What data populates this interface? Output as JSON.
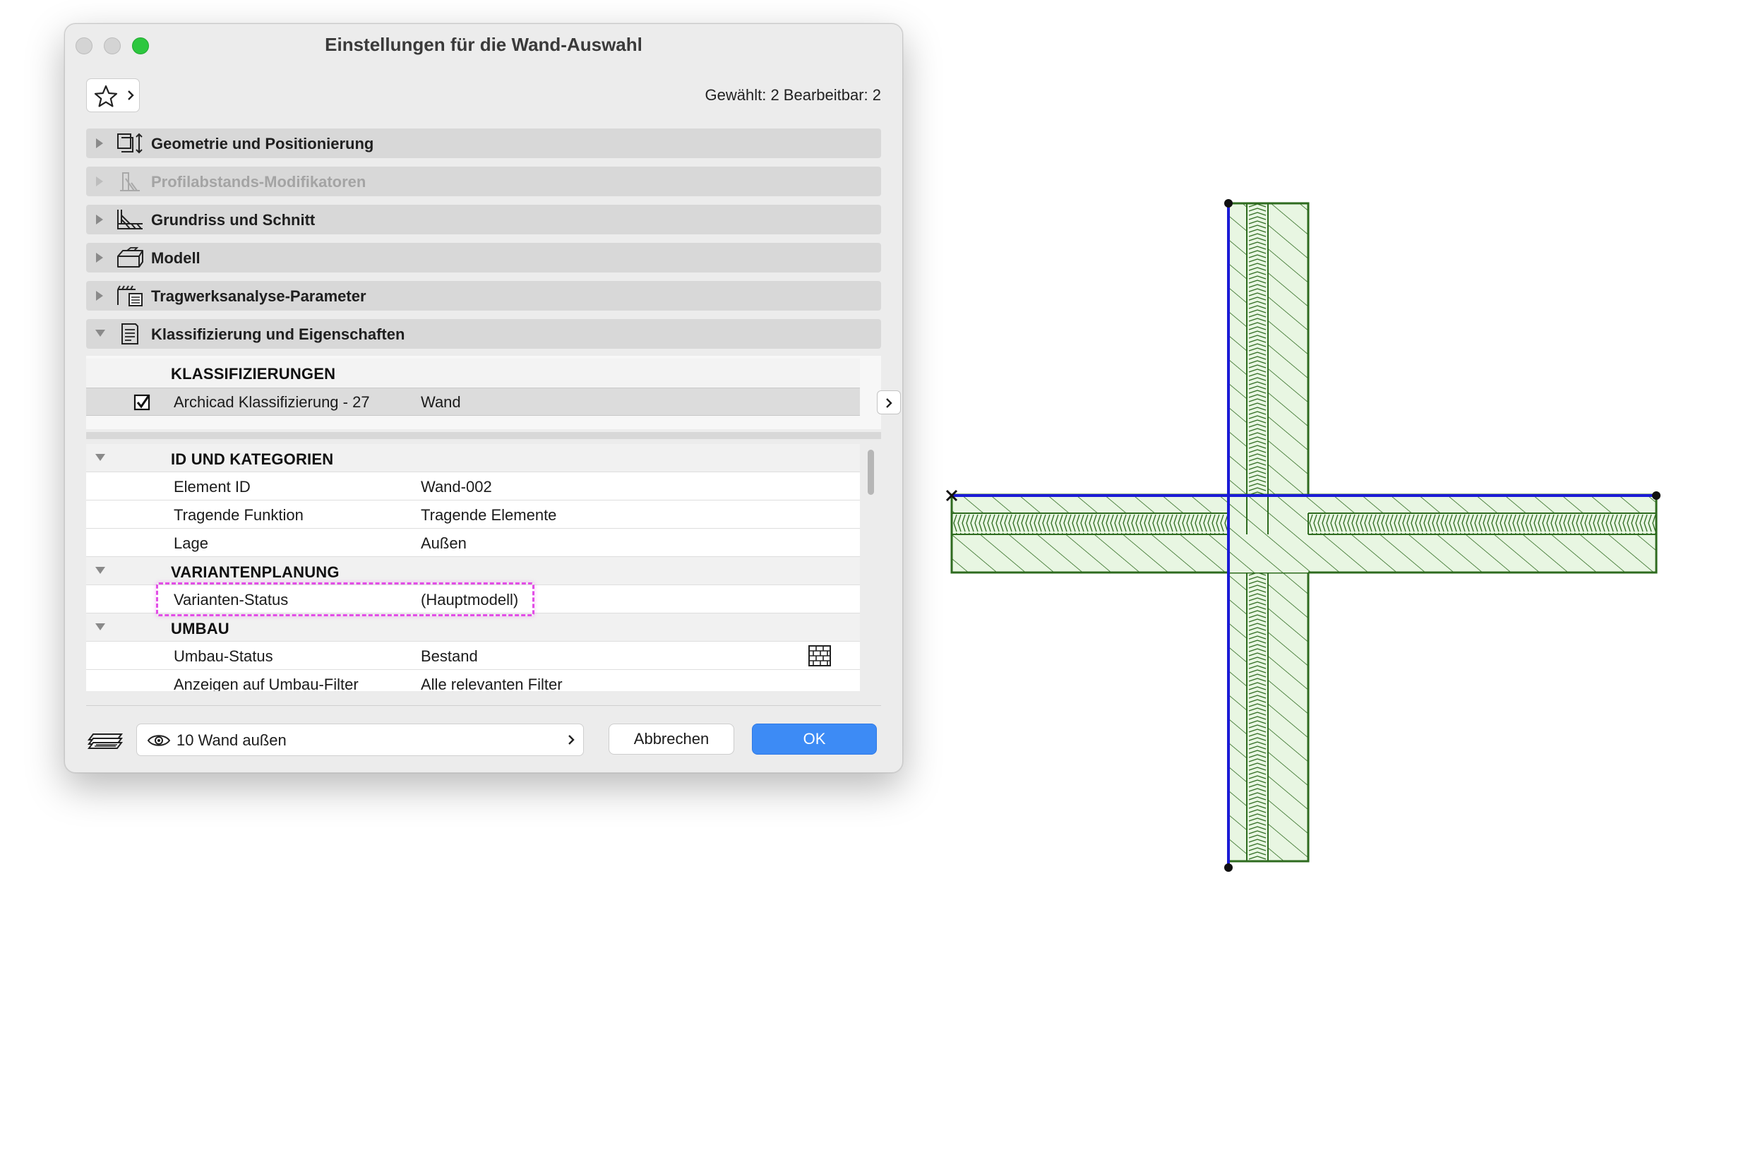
{
  "window": {
    "title": "Einstellungen für die Wand-Auswahl"
  },
  "selection_info": "Gewählt: 2 Bearbeitbar: 2",
  "sections": [
    {
      "label": "Geometrie und Positionierung",
      "icon": "geometry-icon",
      "state": "collapsed",
      "enabled": true
    },
    {
      "label": "Profilabstands-Modifikatoren",
      "icon": "profile-modifier-icon",
      "state": "collapsed",
      "enabled": false
    },
    {
      "label": "Grundriss und Schnitt",
      "icon": "floor-plan-icon",
      "state": "collapsed",
      "enabled": true
    },
    {
      "label": "Modell",
      "icon": "model-icon",
      "state": "collapsed",
      "enabled": true
    },
    {
      "label": "Tragwerksanalyse-Parameter",
      "icon": "structural-analysis-icon",
      "state": "collapsed",
      "enabled": true
    },
    {
      "label": "Klassifizierung und Eigenschaften",
      "icon": "classification-icon",
      "state": "expanded",
      "enabled": true
    }
  ],
  "classifications": {
    "header": "KLASSIFIZIERUNGEN",
    "rows": [
      {
        "checked": true,
        "name": "Archicad Klassifizierung - 27",
        "value": "Wand"
      }
    ]
  },
  "properties": {
    "groups": [
      {
        "header": "ID UND KATEGORIEN",
        "rows": [
          {
            "name": "Element ID",
            "value": "Wand-002"
          },
          {
            "name": "Tragende Funktion",
            "value": "Tragende Elemente"
          },
          {
            "name": "Lage",
            "value": "Außen"
          }
        ]
      },
      {
        "header": "VARIANTENPLANUNG",
        "rows": [
          {
            "name": "Varianten-Status",
            "value": "(Hauptmodell)"
          }
        ]
      },
      {
        "header": "UMBAU",
        "rows": [
          {
            "name": "Umbau-Status",
            "value": "Bestand",
            "icon": "brick-wall-icon"
          },
          {
            "name": "Anzeigen auf Umbau-Filter",
            "value": "Alle relevanten Filter"
          }
        ]
      }
    ]
  },
  "footer": {
    "layer_label": "10 Wand außen",
    "cancel_label": "Abbrechen",
    "ok_label": "OK"
  },
  "colors": {
    "ok_button": "#3d8bf5",
    "highlight": "#e24de6",
    "wall_fill": "#e8f6e2",
    "wall_stroke": "#2e6b1f",
    "reference_line": "#1b1bd6"
  }
}
